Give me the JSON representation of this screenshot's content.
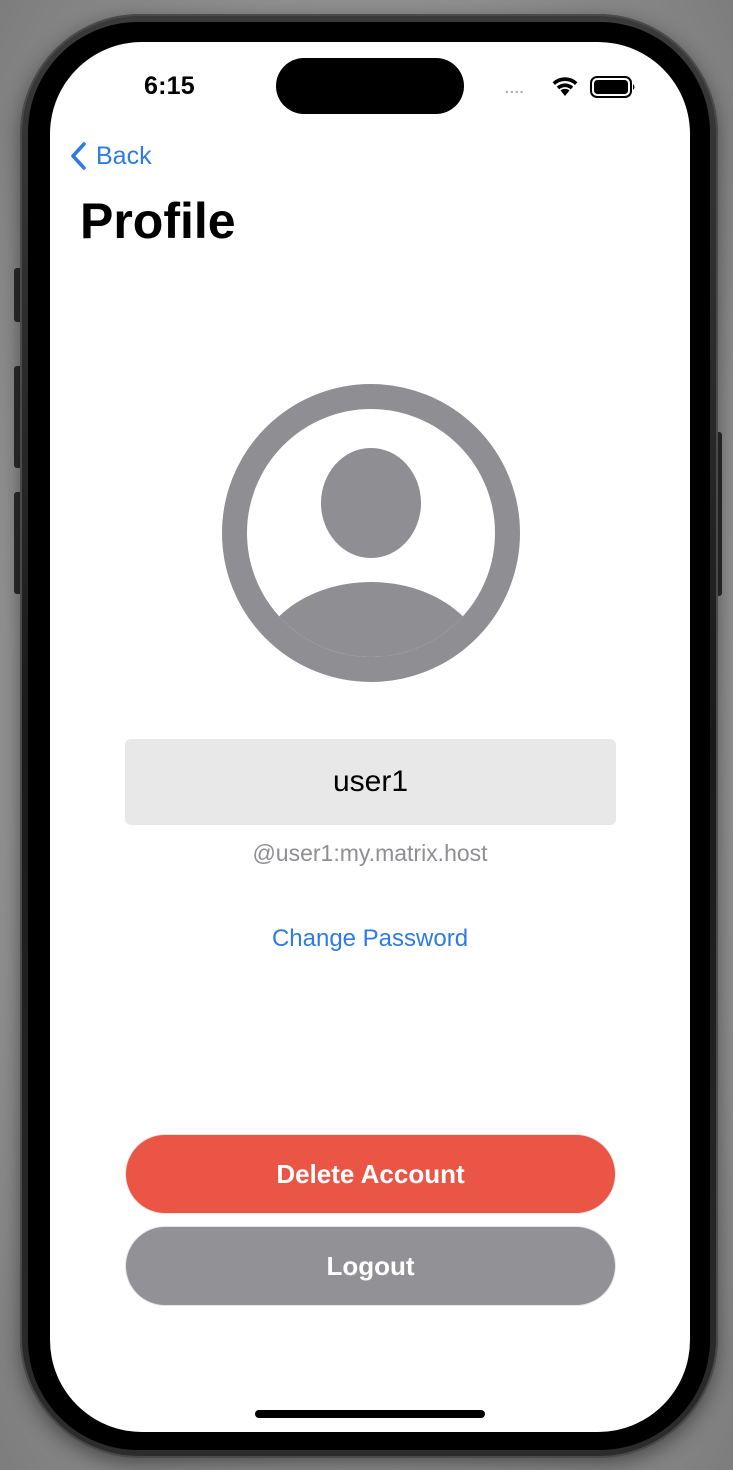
{
  "status_bar": {
    "time": "6:15",
    "signal": "....",
    "wifi_icon": "wifi-icon",
    "battery_icon": "battery-icon"
  },
  "nav": {
    "back_label": "Back",
    "back_icon": "chevron-left-icon",
    "title": "Profile"
  },
  "profile": {
    "avatar_icon": "person-circle-icon",
    "display_name": "user1",
    "user_id": "@user1:my.matrix.host",
    "change_password_label": "Change Password"
  },
  "actions": {
    "delete_label": "Delete Account",
    "logout_label": "Logout"
  },
  "colors": {
    "accent": "#2f7be6",
    "destructive": "#eb5545",
    "secondary_button": "#929296",
    "avatar_gray": "#8e8e93",
    "field_background": "#e8e8e8"
  }
}
